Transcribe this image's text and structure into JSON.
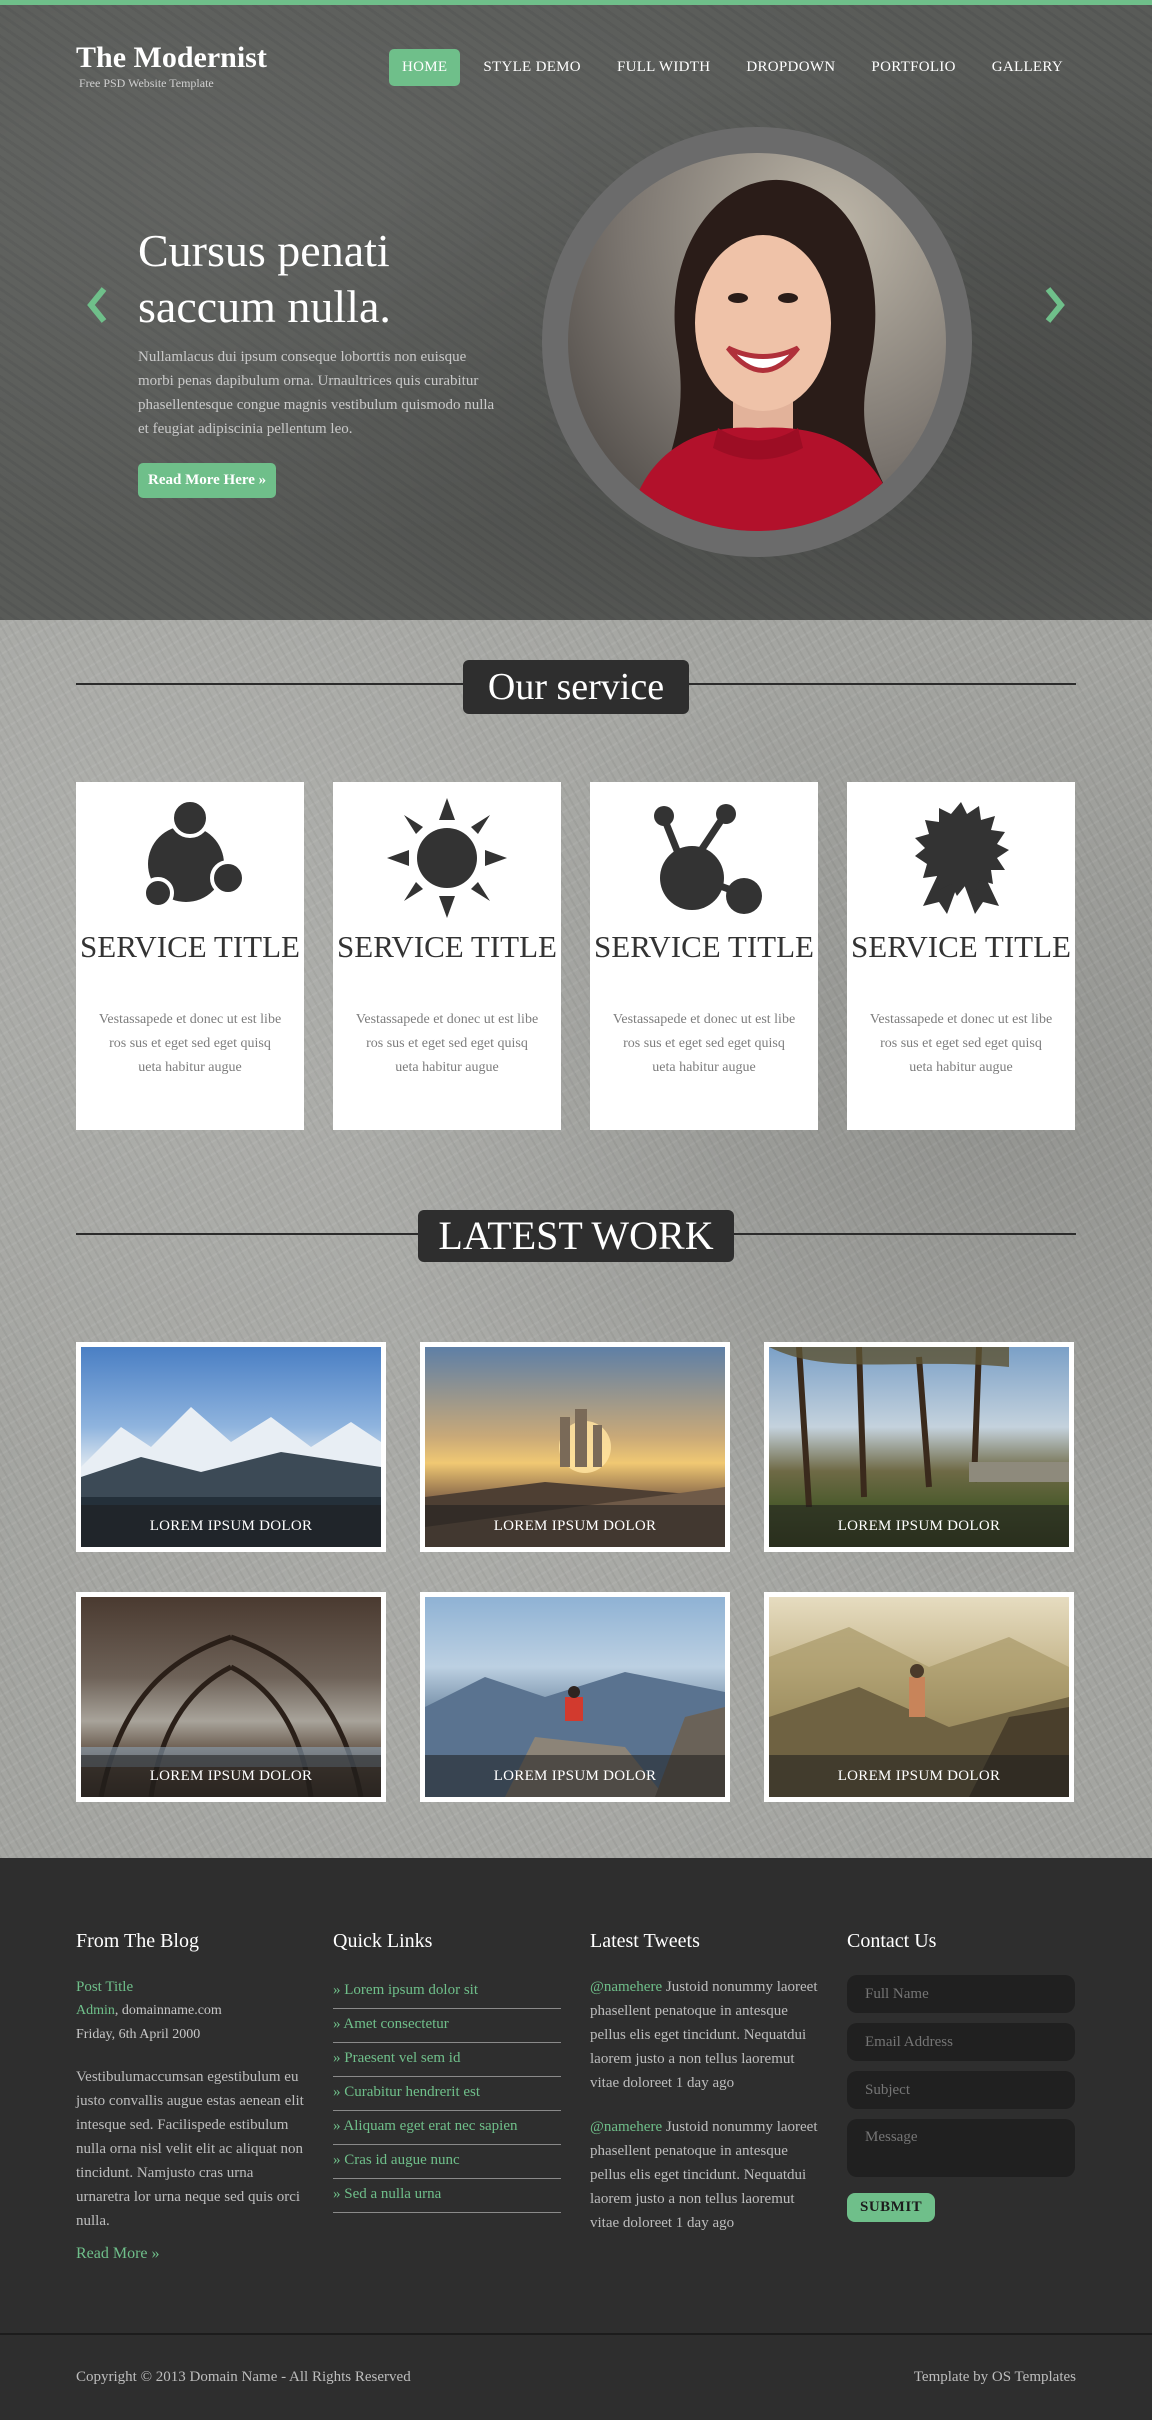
{
  "brand": {
    "title": "The Modernist",
    "subtitle": "Free PSD Website Template",
    "accent": "#6fbf8a"
  },
  "nav": {
    "items": [
      {
        "label": "HOME",
        "active": true
      },
      {
        "label": "STYLE DEMO"
      },
      {
        "label": "FULL WIDTH"
      },
      {
        "label": "DROPDOWN"
      },
      {
        "label": "PORTFOLIO"
      },
      {
        "label": "GALLERY"
      }
    ]
  },
  "hero": {
    "title": "Cursus penati saccum nulla.",
    "text": "Nullamlacus dui ipsum conseque loborttis non euisque morbi penas dapibulum orna. Urnaultrices quis curabitur phasellentesque congue magnis vestibulum quismodo nulla et feugiat adipiscinia pellentum leo.",
    "button": "Read More Here »",
    "prev_icon": "chevron-left-icon",
    "next_icon": "chevron-right-icon"
  },
  "services": {
    "heading": "Our service",
    "cards": [
      {
        "icon": "molecule-cluster-icon",
        "title": "SERVICE TITLE",
        "text": "Vestassapede et donec ut est libe ros sus et eget sed eget quisq ueta habitur augue"
      },
      {
        "icon": "sun-icon",
        "title": "SERVICE TITLE",
        "text": "Vestassapede et donec ut est libe ros sus et eget sed eget quisq ueta habitur augue"
      },
      {
        "icon": "atom-icon",
        "title": "SERVICE TITLE",
        "text": "Vestassapede et donec ut est libe ros sus et eget sed eget quisq ueta habitur augue"
      },
      {
        "icon": "award-badge-icon",
        "title": "SERVICE TITLE",
        "text": "Vestassapede et donec ut est libe ros sus et eget sed eget quisq ueta habitur augue"
      }
    ]
  },
  "work": {
    "heading": "LATEST WORK",
    "items": [
      {
        "caption": "LOREM IPSUM DOLOR",
        "scene": "snowy-mountains"
      },
      {
        "caption": "LOREM IPSUM DOLOR",
        "scene": "city-sunrise"
      },
      {
        "caption": "LOREM IPSUM DOLOR",
        "scene": "park-trees"
      },
      {
        "caption": "LOREM IPSUM DOLOR",
        "scene": "tree-tunnel"
      },
      {
        "caption": "LOREM IPSUM DOLOR",
        "scene": "mountain-hiker"
      },
      {
        "caption": "LOREM IPSUM DOLOR",
        "scene": "valley-hiker"
      }
    ]
  },
  "footer": {
    "blog": {
      "heading": "From The Blog",
      "post_title": "Post Title",
      "author": "Admin",
      "domain": ", domainname.com",
      "date": "Friday, 6th April 2000",
      "body": "Vestibulumaccumsan egestibulum eu justo convallis augue estas aenean elit intesque sed. Facilispede estibulum nulla orna nisl velit elit ac aliquat non tincidunt. Namjusto cras urna urnaretra lor urna neque sed quis orci nulla.",
      "more": "Read More »"
    },
    "links": {
      "heading": "Quick Links",
      "items": [
        "» Lorem ipsum dolor sit",
        "» Amet consectetur",
        "» Praesent vel sem id",
        "» Curabitur hendrerit est",
        "» Aliquam eget erat nec sapien",
        "» Cras id augue nunc",
        "» Sed a nulla urna"
      ]
    },
    "tweets": {
      "heading": "Latest Tweets",
      "items": [
        {
          "handle": "@namehere",
          "text": " Justoid nonummy laoreet phasellent penatoque in antesque pellus elis eget tincidunt. Nequatdui laorem justo a non tellus laoremut vitae doloreet 1 day ago"
        },
        {
          "handle": "@namehere",
          "text": " Justoid nonummy laoreet phasellent penatoque in antesque pellus elis eget tincidunt. Nequatdui laorem justo a non tellus laoremut vitae doloreet 1 day ago"
        }
      ]
    },
    "contact": {
      "heading": "Contact Us",
      "full_name_placeholder": "Full Name",
      "email_placeholder": "Email Address",
      "subject_placeholder": "Subject",
      "message_placeholder": "Message",
      "submit": "SUBMIT"
    }
  },
  "copyright": {
    "left": "Copyright © 2013 Domain Name - All Rights Reserved",
    "right": "Template by OS Templates"
  }
}
